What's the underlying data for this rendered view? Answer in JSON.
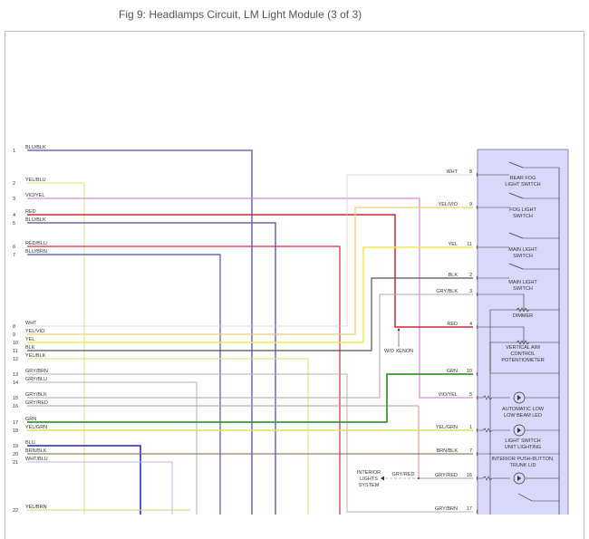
{
  "title": "Fig 9: Headlamps Circuit, LM Light Module (3 of 3)",
  "left_pins": [
    {
      "pin": "1",
      "wire": "BLU/BLK",
      "color": "#5050b0"
    },
    {
      "pin": "2",
      "wire": "YEL/BLU",
      "color": "#e6dc7a"
    },
    {
      "pin": "3",
      "wire": "VIO/YEL",
      "color": "#d070c8"
    },
    {
      "pin": "4",
      "wire": "RED",
      "color": "#c82838"
    },
    {
      "pin": "5",
      "wire": "BLU/BLK",
      "color": "#6a6aa0"
    },
    {
      "pin": "6",
      "wire": "RED/BLU",
      "color": "#c83048"
    },
    {
      "pin": "7",
      "wire": "BLU/BRN",
      "color": "#5050a8"
    },
    {
      "pin": "8",
      "wire": "WHT",
      "color": "#d0d0d0"
    },
    {
      "pin": "9",
      "wire": "YEL/VIO",
      "color": "#e8d070"
    },
    {
      "pin": "10",
      "wire": "YEL",
      "color": "#f0ea50"
    },
    {
      "pin": "11",
      "wire": "BLK",
      "color": "#555555"
    },
    {
      "pin": "12",
      "wire": "YEL/BLK",
      "color": "#dcdc70"
    },
    {
      "pin": "13",
      "wire": "GRY/BRN",
      "color": "#b8b0b0"
    },
    {
      "pin": "14",
      "wire": "GRY/BLU",
      "color": "#b0b0c8"
    },
    {
      "pin": "15",
      "wire": "GRY/BLK",
      "color": "#a8a8a8"
    },
    {
      "pin": "16",
      "wire": "GRY/RED",
      "color": "#c89090"
    },
    {
      "pin": "17",
      "wire": "GRN",
      "color": "#3a9a30"
    },
    {
      "pin": "18",
      "wire": "YEL/GRN",
      "color": "#e0e050"
    },
    {
      "pin": "19",
      "wire": "BLU",
      "color": "#2020c0"
    },
    {
      "pin": "20",
      "wire": "BRN/BLK",
      "color": "#806040"
    },
    {
      "pin": "21",
      "wire": "WHT/BLU",
      "color": "#b8b8dc"
    },
    {
      "pin": "22",
      "wire": "YEL/BRN",
      "color": "#d8d070"
    }
  ],
  "right_pins": [
    {
      "pin": "8",
      "wire": "WHT"
    },
    {
      "pin": "9",
      "wire": "YEL/VIO"
    },
    {
      "pin": "11",
      "wire": "YEL"
    },
    {
      "pin": "2",
      "wire": "BLK"
    },
    {
      "pin": "3",
      "wire": "GRY/BLK"
    },
    {
      "pin": "4",
      "wire": "RED"
    },
    {
      "pin": "10",
      "wire": "GRN"
    },
    {
      "pin": "5",
      "wire": "VIO/YEL"
    },
    {
      "pin": "1",
      "wire": "YEL/GRN"
    },
    {
      "pin": "7",
      "wire": "BRN/BLK"
    },
    {
      "pin": "16",
      "wire": "GRY/RED"
    },
    {
      "pin": "17",
      "wire": "GRY/BRN"
    }
  ],
  "components": [
    [
      "REAR FOG",
      "LIGHT SWITCH"
    ],
    [
      "FOG LIGHT",
      "SWITCH"
    ],
    [
      "MAIN LIGHT",
      "SWITCH"
    ],
    [
      "MAIN LIGHT",
      "SWITCH"
    ],
    [
      "DIMMER"
    ],
    [
      "VERTICAL AIM",
      "CONTROL",
      "POTENTIOMETER"
    ],
    [
      "AUTOMATIC LOW",
      "LOW BEAM LED"
    ],
    [
      "LIGHT SWITCH",
      "UNIT LIGHTING"
    ],
    [
      "INTERIOR PUSH-BUTTON,",
      "TRUNK LID"
    ]
  ],
  "notes": {
    "wo_xenon": "W/O XENON",
    "interior_lights": [
      "INTERIOR",
      "LIGHTS",
      "SYSTEM"
    ],
    "interior_wire": "GRY/RED"
  },
  "module_fill": "#d8d8fa"
}
